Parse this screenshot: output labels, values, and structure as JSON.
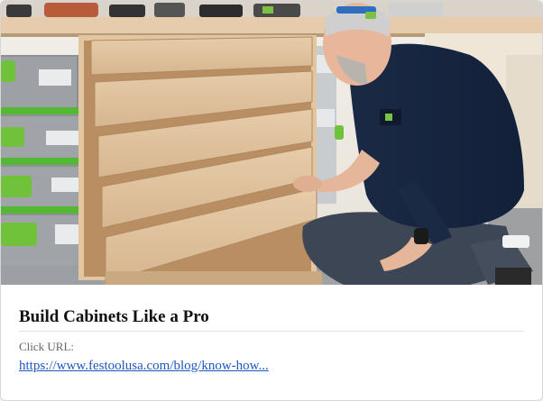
{
  "card": {
    "image_alt": "Man kneeling beside a plywood cabinet with open drawers next to stacked green and grey tool cases",
    "title": "Build Cabinets Like a Pro",
    "url_label": "Click URL:",
    "url_text": "https://www.festoolusa.com/blog/know-how..."
  }
}
